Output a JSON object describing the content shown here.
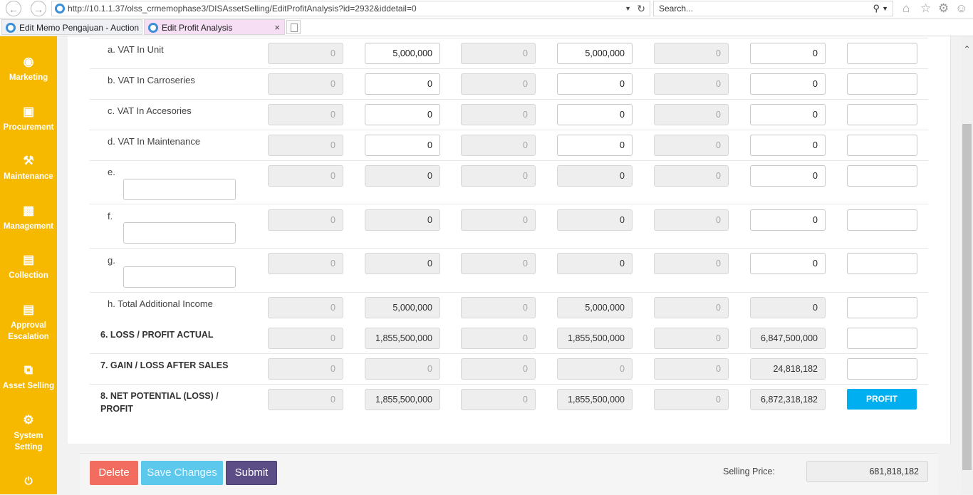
{
  "browser": {
    "url": "http://10.1.1.37/olss_crmemophase3/DISAssetSelling/EditProfitAnalysis?id=2932&iddetail=0",
    "search_placeholder": "Search...",
    "tabs": [
      {
        "label": "Edit Memo Pengajuan - Auction"
      },
      {
        "label": "Edit Profit Analysis"
      }
    ],
    "tab_close": "×"
  },
  "sidebar": {
    "items": [
      {
        "label": "Marketing",
        "icon": "globe-icon"
      },
      {
        "label": "Procurement",
        "icon": "cart-icon"
      },
      {
        "label": "Maintenance",
        "icon": "wrench-icon"
      },
      {
        "label": "Management",
        "icon": "truck-icon"
      },
      {
        "label": "Collection",
        "icon": "list-icon"
      },
      {
        "label": "Approval Escalation",
        "icon": "list-icon"
      },
      {
        "label": "Asset Selling",
        "icon": "external-link-icon"
      },
      {
        "label": "System Setting",
        "icon": "gear-icon"
      }
    ]
  },
  "table": {
    "rows": [
      {
        "label": "a. VAT In Unit",
        "cells": [
          "0",
          "5,000,000",
          "0",
          "5,000,000",
          "0",
          "0",
          ""
        ]
      },
      {
        "label": "b. VAT In Carroseries",
        "cells": [
          "0",
          "0",
          "0",
          "0",
          "0",
          "0",
          ""
        ]
      },
      {
        "label": "c. VAT In Accesories",
        "cells": [
          "0",
          "0",
          "0",
          "0",
          "0",
          "0",
          ""
        ]
      },
      {
        "label": "d. VAT In Maintenance",
        "cells": [
          "0",
          "0",
          "0",
          "0",
          "0",
          "0",
          ""
        ]
      },
      {
        "label": "e.",
        "cells": [
          "0",
          "0",
          "0",
          "0",
          "0",
          "0",
          ""
        ]
      },
      {
        "label": "f.",
        "cells": [
          "0",
          "0",
          "0",
          "0",
          "0",
          "0",
          ""
        ]
      },
      {
        "label": "g.",
        "cells": [
          "0",
          "0",
          "0",
          "0",
          "0",
          "0",
          ""
        ]
      },
      {
        "label": "h. Total Additional Income",
        "cells": [
          "0",
          "5,000,000",
          "0",
          "5,000,000",
          "0",
          "0",
          ""
        ]
      },
      {
        "label": "6. LOSS / PROFIT ACTUAL",
        "cells": [
          "0",
          "1,855,500,000",
          "0",
          "1,855,500,000",
          "0",
          "6,847,500,000",
          ""
        ]
      },
      {
        "label": "7. GAIN / LOSS AFTER SALES",
        "cells": [
          "0",
          "0",
          "0",
          "0",
          "0",
          "24,818,182",
          ""
        ]
      },
      {
        "label_line1": "8. NET POTENTIAL (LOSS) /",
        "label_line2": "PROFIT",
        "cells": [
          "0",
          "1,855,500,000",
          "0",
          "1,855,500,000",
          "0",
          "6,872,318,182"
        ],
        "status": "PROFIT"
      }
    ]
  },
  "footer": {
    "delete_label": "Delete",
    "save_label": "Save Changes",
    "submit_label": "Submit",
    "selling_price_label": "Selling Price:",
    "selling_price_value": "681,818,182"
  },
  "colors": {
    "sidebar": "#f7b900",
    "profit_badge": "#00aff0",
    "delete": "#f26c5f",
    "save": "#5bc8ec",
    "submit": "#5c4d87"
  }
}
